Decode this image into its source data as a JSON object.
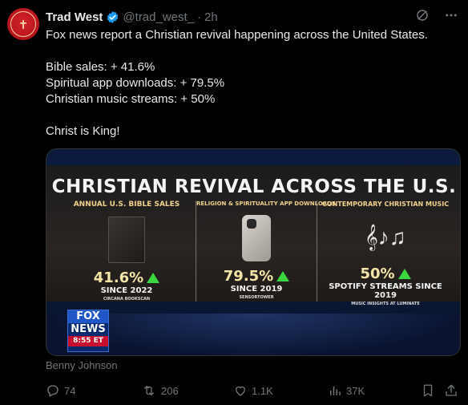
{
  "tweet": {
    "author_name": "Trad West",
    "handle": "@trad_west_",
    "separator": "·",
    "time": "2h",
    "lines": [
      "Fox news report a Christian revival happening across the United States.",
      "",
      "Bible sales: + 41.6%",
      "Spiritual app downloads: + 79.5%",
      "Christian music streams: + 50%",
      "",
      "Christ is King!"
    ]
  },
  "media": {
    "title": "CHRISTIAN REVIVAL ACROSS THE U.S.",
    "columns": [
      {
        "heading": "ANNUAL U.S. BIBLE SALES",
        "value": "41.6%",
        "since": "SINCE 2022",
        "source": "CIRCANA BOOKSCAN"
      },
      {
        "heading": "RELIGION & SPIRITUALITY APP DOWNLOADS",
        "value": "79.5%",
        "since": "SINCE 2019",
        "source": "SENSORTOWER"
      },
      {
        "heading": "CONTEMPORARY CHRISTIAN MUSIC",
        "value": "50%",
        "since": "SPOTIFY STREAMS SINCE 2019",
        "source": "MUSIC INSIGHTS AT LUMINATE"
      }
    ],
    "logo": {
      "line1": "FOX",
      "line2": "NEWS",
      "time": "8:55 ET"
    }
  },
  "credit": "Benny Johnson",
  "actions": {
    "replies": "74",
    "reposts": "206",
    "likes": "1.1K",
    "views": "37K"
  },
  "icons": [
    "verified-badge-icon",
    "grok-icon",
    "more-icon",
    "reply-icon",
    "repost-icon",
    "like-icon",
    "views-icon",
    "bookmark-icon",
    "share-icon"
  ],
  "colors": {
    "background": "#000000",
    "text": "#e7e9ea",
    "muted": "#71767b",
    "verified": "#1d9bf0"
  }
}
